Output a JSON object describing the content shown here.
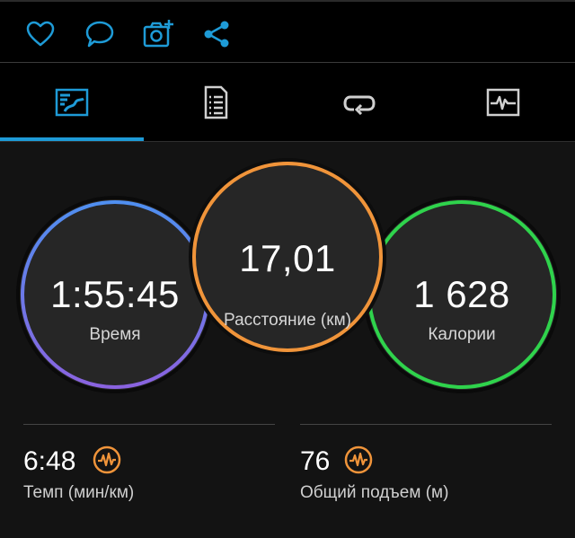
{
  "colors": {
    "accent": "#1e9bd7",
    "time_ring_start": "#4f8ff0",
    "time_ring_end": "#8a63e0",
    "distance_ring": "#f0943a",
    "calories_ring": "#2fd34c",
    "stat_icon": "#f0943a"
  },
  "actions": [
    {
      "icon": "heart-icon"
    },
    {
      "icon": "comment-icon"
    },
    {
      "icon": "add-photo-icon"
    },
    {
      "icon": "share-icon"
    }
  ],
  "tabs": [
    {
      "icon": "overview-tab-icon",
      "selected": true
    },
    {
      "icon": "details-tab-icon",
      "selected": false
    },
    {
      "icon": "laps-tab-icon",
      "selected": false
    },
    {
      "icon": "charts-tab-icon",
      "selected": false
    }
  ],
  "summary": {
    "time": {
      "value": "1:55:45",
      "label": "Время"
    },
    "distance": {
      "value": "17,01",
      "label": "Расстояние (км)"
    },
    "calories": {
      "value": "1 628",
      "label": "Калории"
    }
  },
  "stats": {
    "pace": {
      "value": "6:48",
      "label": "Темп (мин/км)",
      "icon": "activity-wave-icon"
    },
    "ascent": {
      "value": "76",
      "label": "Общий подъем (м)",
      "icon": "activity-wave-icon"
    }
  }
}
